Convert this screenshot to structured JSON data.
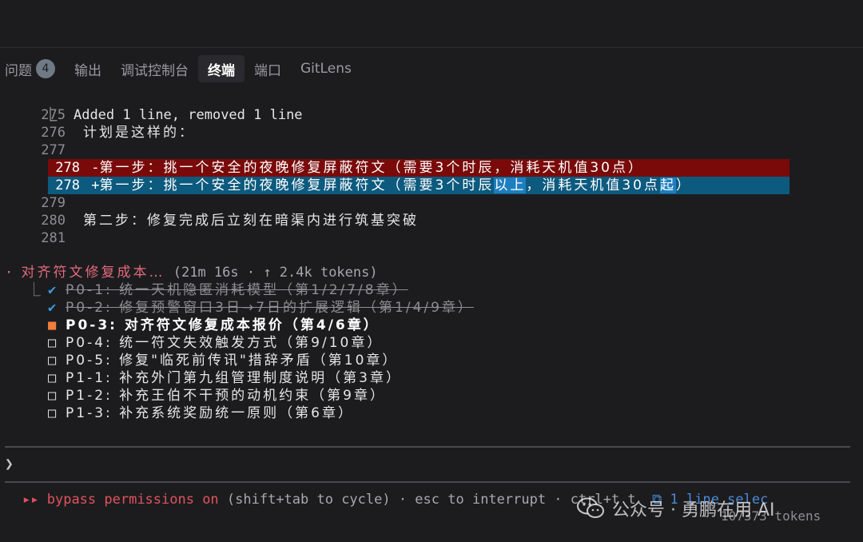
{
  "panel": {
    "tabs": [
      {
        "label": "问题",
        "badge": "4"
      },
      {
        "label": "输出"
      },
      {
        "label": "调试控制台"
      },
      {
        "label": "终端"
      },
      {
        "label": "端口"
      },
      {
        "label": "GitLens"
      }
    ]
  },
  "edit": {
    "summary_prefix": "⎿",
    "summary": "Added 1 line, removed 1 line",
    "lines": [
      {
        "n": "275",
        "text": ""
      },
      {
        "n": "276",
        "text": "计划是这样的："
      },
      {
        "n": "277",
        "text": ""
      }
    ],
    "removed": {
      "n": "278",
      "sign": "-",
      "text": "第一步：挑一个安全的夜晚修复屏蔽符文（需要3个时辰，消耗天机值30点）"
    },
    "added": {
      "n": "278",
      "sign": "+",
      "text_a": "第一步：挑一个安全的夜晚修复屏蔽符文（需要3个时辰",
      "hl_a": "以上",
      "text_b": "，消耗天机值30点",
      "hl_b": "起",
      "text_c": "）"
    },
    "after": [
      {
        "n": "279",
        "text": ""
      },
      {
        "n": "280",
        "text": "第二步：修复完成后立刻在暗渠内进行筑基突破"
      },
      {
        "n": "281",
        "text": ""
      }
    ]
  },
  "todo": {
    "bullet": "·",
    "title": "对齐符文修复成本…",
    "meta": " (21m 16s · ↑ 2.4k tokens)",
    "branch": "⎿",
    "items": [
      {
        "mark": "✔",
        "text": "P0-1: 统一天机隐匿消耗模型（第1/2/7/8章）",
        "state": "done"
      },
      {
        "mark": "✔",
        "text": "P0-2: 修复预警窗口3日→7日的扩展逻辑（第1/4/9章）",
        "state": "done"
      },
      {
        "mark": "■",
        "text": "P0-3: 对齐符文修复成本报价（第4/6章）",
        "state": "current"
      },
      {
        "mark": "□",
        "text": "P0-4: 统一符文失效触发方式（第9/10章）",
        "state": "pending"
      },
      {
        "mark": "□",
        "text": "P0-5: 修复\"临死前传讯\"措辞矛盾（第10章）",
        "state": "pending"
      },
      {
        "mark": "□",
        "text": "P1-1: 补充外门第九组管理制度说明（第3章）",
        "state": "pending"
      },
      {
        "mark": "□",
        "text": "P1-2: 补充王伯不干预的动机约束（第9章）",
        "state": "pending"
      },
      {
        "mark": "□",
        "text": "P1-3: 补充系统奖励统一原则（第6章）",
        "state": "pending"
      }
    ]
  },
  "prompt": {
    "symbol": "❯"
  },
  "status": {
    "arrows": "▸▸",
    "mode": "bypass permissions on",
    "hint": " (shift+tab to cycle) · esc to interrupt · ctrl+t t",
    "selection": "⧉ 1 line selec",
    "tokens": "107373 tokens"
  },
  "watermark": {
    "text": "公众号 · 勇鹏在用 AI"
  },
  "colors": {
    "diff_removed": "#7a0a0a",
    "diff_added": "#0c5a7e",
    "todo_title": "#e16a7c",
    "status_red": "#e2525f",
    "check_blue": "#3a9be0",
    "current_orange": "#f07d3c"
  }
}
